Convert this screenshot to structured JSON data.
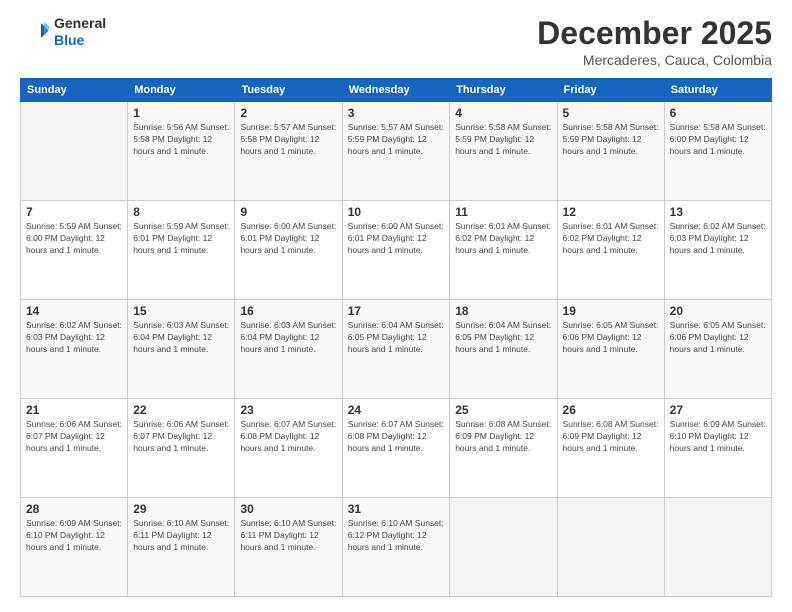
{
  "header": {
    "logo_general": "General",
    "logo_blue": "Blue",
    "month_title": "December 2025",
    "location": "Mercaderes, Cauca, Colombia"
  },
  "calendar": {
    "days_of_week": [
      "Sunday",
      "Monday",
      "Tuesday",
      "Wednesday",
      "Thursday",
      "Friday",
      "Saturday"
    ],
    "weeks": [
      [
        {
          "day": "",
          "info": ""
        },
        {
          "day": "1",
          "info": "Sunrise: 5:56 AM\nSunset: 5:58 PM\nDaylight: 12 hours\nand 1 minute."
        },
        {
          "day": "2",
          "info": "Sunrise: 5:57 AM\nSunset: 5:58 PM\nDaylight: 12 hours\nand 1 minute."
        },
        {
          "day": "3",
          "info": "Sunrise: 5:57 AM\nSunset: 5:59 PM\nDaylight: 12 hours\nand 1 minute."
        },
        {
          "day": "4",
          "info": "Sunrise: 5:58 AM\nSunset: 5:59 PM\nDaylight: 12 hours\nand 1 minute."
        },
        {
          "day": "5",
          "info": "Sunrise: 5:58 AM\nSunset: 5:59 PM\nDaylight: 12 hours\nand 1 minute."
        },
        {
          "day": "6",
          "info": "Sunrise: 5:58 AM\nSunset: 6:00 PM\nDaylight: 12 hours\nand 1 minute."
        }
      ],
      [
        {
          "day": "7",
          "info": "Sunrise: 5:59 AM\nSunset: 6:00 PM\nDaylight: 12 hours\nand 1 minute."
        },
        {
          "day": "8",
          "info": "Sunrise: 5:59 AM\nSunset: 6:01 PM\nDaylight: 12 hours\nand 1 minute."
        },
        {
          "day": "9",
          "info": "Sunrise: 6:00 AM\nSunset: 6:01 PM\nDaylight: 12 hours\nand 1 minute."
        },
        {
          "day": "10",
          "info": "Sunrise: 6:00 AM\nSunset: 6:01 PM\nDaylight: 12 hours\nand 1 minute."
        },
        {
          "day": "11",
          "info": "Sunrise: 6:01 AM\nSunset: 6:02 PM\nDaylight: 12 hours\nand 1 minute."
        },
        {
          "day": "12",
          "info": "Sunrise: 6:01 AM\nSunset: 6:02 PM\nDaylight: 12 hours\nand 1 minute."
        },
        {
          "day": "13",
          "info": "Sunrise: 6:02 AM\nSunset: 6:03 PM\nDaylight: 12 hours\nand 1 minute."
        }
      ],
      [
        {
          "day": "14",
          "info": "Sunrise: 6:02 AM\nSunset: 6:03 PM\nDaylight: 12 hours\nand 1 minute."
        },
        {
          "day": "15",
          "info": "Sunrise: 6:03 AM\nSunset: 6:04 PM\nDaylight: 12 hours\nand 1 minute."
        },
        {
          "day": "16",
          "info": "Sunrise: 6:03 AM\nSunset: 6:04 PM\nDaylight: 12 hours\nand 1 minute."
        },
        {
          "day": "17",
          "info": "Sunrise: 6:04 AM\nSunset: 6:05 PM\nDaylight: 12 hours\nand 1 minute."
        },
        {
          "day": "18",
          "info": "Sunrise: 6:04 AM\nSunset: 6:05 PM\nDaylight: 12 hours\nand 1 minute."
        },
        {
          "day": "19",
          "info": "Sunrise: 6:05 AM\nSunset: 6:06 PM\nDaylight: 12 hours\nand 1 minute."
        },
        {
          "day": "20",
          "info": "Sunrise: 6:05 AM\nSunset: 6:06 PM\nDaylight: 12 hours\nand 1 minute."
        }
      ],
      [
        {
          "day": "21",
          "info": "Sunrise: 6:06 AM\nSunset: 6:07 PM\nDaylight: 12 hours\nand 1 minute."
        },
        {
          "day": "22",
          "info": "Sunrise: 6:06 AM\nSunset: 6:07 PM\nDaylight: 12 hours\nand 1 minute."
        },
        {
          "day": "23",
          "info": "Sunrise: 6:07 AM\nSunset: 6:08 PM\nDaylight: 12 hours\nand 1 minute."
        },
        {
          "day": "24",
          "info": "Sunrise: 6:07 AM\nSunset: 6:08 PM\nDaylight: 12 hours\nand 1 minute."
        },
        {
          "day": "25",
          "info": "Sunrise: 6:08 AM\nSunset: 6:09 PM\nDaylight: 12 hours\nand 1 minute."
        },
        {
          "day": "26",
          "info": "Sunrise: 6:08 AM\nSunset: 6:09 PM\nDaylight: 12 hours\nand 1 minute."
        },
        {
          "day": "27",
          "info": "Sunrise: 6:09 AM\nSunset: 6:10 PM\nDaylight: 12 hours\nand 1 minute."
        }
      ],
      [
        {
          "day": "28",
          "info": "Sunrise: 6:09 AM\nSunset: 6:10 PM\nDaylight: 12 hours\nand 1 minute."
        },
        {
          "day": "29",
          "info": "Sunrise: 6:10 AM\nSunset: 6:11 PM\nDaylight: 12 hours\nand 1 minute."
        },
        {
          "day": "30",
          "info": "Sunrise: 6:10 AM\nSunset: 6:11 PM\nDaylight: 12 hours\nand 1 minute."
        },
        {
          "day": "31",
          "info": "Sunrise: 6:10 AM\nSunset: 6:12 PM\nDaylight: 12 hours\nand 1 minute."
        },
        {
          "day": "",
          "info": ""
        },
        {
          "day": "",
          "info": ""
        },
        {
          "day": "",
          "info": ""
        }
      ]
    ]
  }
}
